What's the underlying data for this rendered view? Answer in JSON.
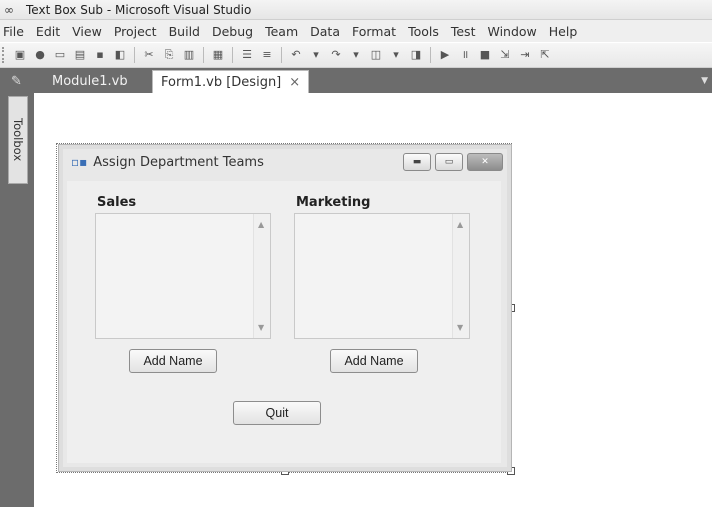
{
  "window": {
    "title": "Text Box Sub - Microsoft Visual Studio"
  },
  "menu": [
    "File",
    "Edit",
    "View",
    "Project",
    "Build",
    "Debug",
    "Team",
    "Data",
    "Format",
    "Tools",
    "Test",
    "Window",
    "Help"
  ],
  "tabs": {
    "module": "Module1.vb",
    "form": "Form1.vb [Design]",
    "close_glyph": "×"
  },
  "toolbox_label": "Toolbox",
  "form": {
    "title": "Assign Department Teams",
    "sales_label": "Sales",
    "marketing_label": "Marketing",
    "add_name_left": "Add Name",
    "add_name_right": "Add Name",
    "quit": "Quit"
  }
}
